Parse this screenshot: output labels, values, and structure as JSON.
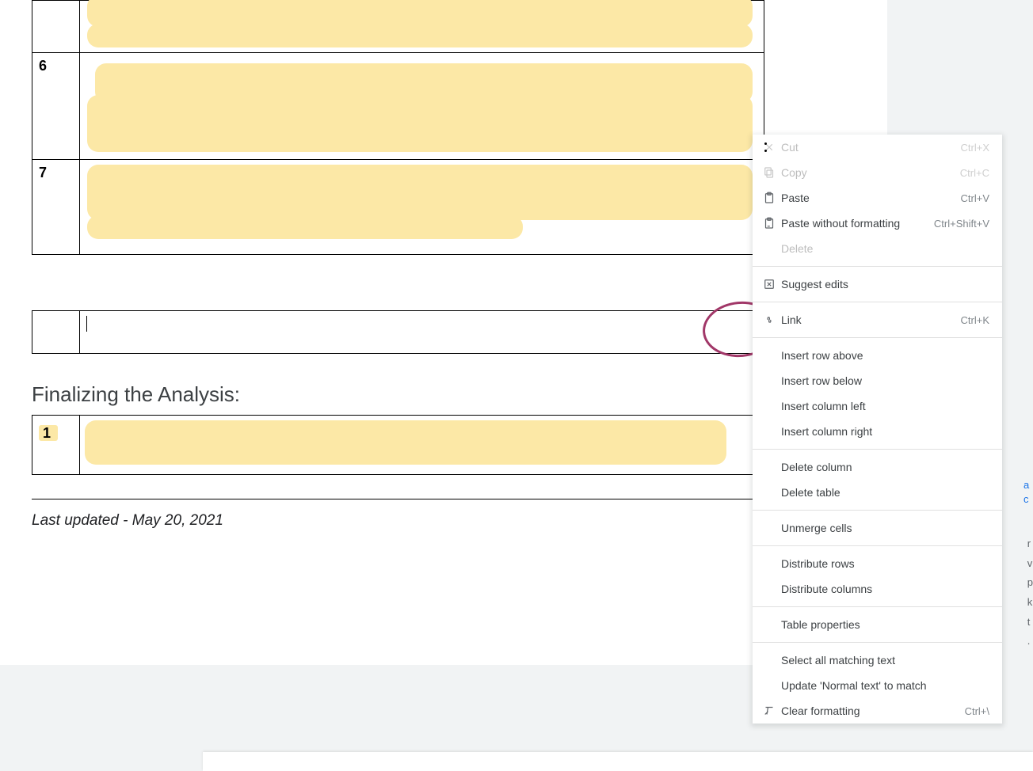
{
  "table_rows": {
    "r1": "6",
    "r2": "7"
  },
  "heading": "Finalizing the Analysis:",
  "final_row_num": "1",
  "updated": "Last updated - May 20, 2021",
  "menu": {
    "cut": {
      "label": "Cut",
      "shortcut": "Ctrl+X"
    },
    "copy": {
      "label": "Copy",
      "shortcut": "Ctrl+C"
    },
    "paste": {
      "label": "Paste",
      "shortcut": "Ctrl+V"
    },
    "paste_wo": {
      "label": "Paste without formatting",
      "shortcut": "Ctrl+Shift+V"
    },
    "delete": {
      "label": "Delete"
    },
    "suggest": {
      "label": "Suggest edits"
    },
    "link": {
      "label": "Link",
      "shortcut": "Ctrl+K"
    },
    "row_above": {
      "label": "Insert row above"
    },
    "row_below": {
      "label": "Insert row below"
    },
    "col_left": {
      "label": "Insert column left"
    },
    "col_right": {
      "label": "Insert column right"
    },
    "del_col": {
      "label": "Delete column"
    },
    "del_table": {
      "label": "Delete table"
    },
    "unmerge": {
      "label": "Unmerge cells"
    },
    "dist_rows": {
      "label": "Distribute rows"
    },
    "dist_cols": {
      "label": "Distribute columns"
    },
    "table_props": {
      "label": "Table properties"
    },
    "select_match": {
      "label": "Select all matching text"
    },
    "update_normal": {
      "label": "Update 'Normal text' to match"
    },
    "clear_fmt": {
      "label": "Clear formatting",
      "shortcut": "Ctrl+\\"
    }
  }
}
